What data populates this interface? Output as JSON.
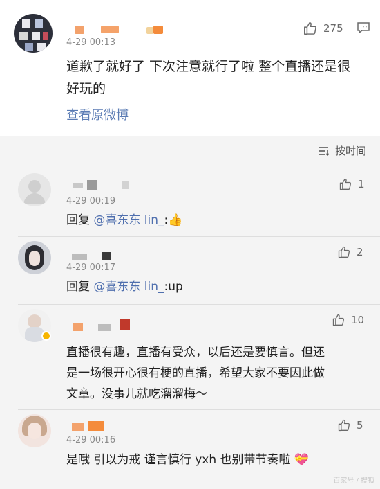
{
  "post": {
    "time": "4-29 00:13",
    "like_count": "275",
    "text_line1": "道歉了就好了 下次注意就行了啦 整个直播还是很",
    "text_line2": "好玩的",
    "view_original": "查看原微博"
  },
  "sort": {
    "label": "按时间"
  },
  "replies": [
    {
      "time": "4-29 00:19",
      "likes": "1",
      "prefix": "回复",
      "mention": "@喜东东 lin_",
      "suffix": ":👍"
    },
    {
      "time": "4-29 00:17",
      "likes": "2",
      "prefix": "回复",
      "mention": "@喜东东 lin_",
      "suffix": ":up"
    },
    {
      "time": "",
      "likes": "10",
      "line1": "直播很有趣，直播有受众，以后还是要慎言。但还",
      "line2": "是一场很开心很有梗的直播，希望大家不要因此做",
      "line3": "文章。没事儿就吃溜溜梅～"
    },
    {
      "time": "4-29 00:16",
      "likes": "5",
      "text": "是哦 引以为戒 谨言慎行 yxh 也别带节奏啦 💝"
    }
  ],
  "watermark": "百家号 / 搜狐",
  "icons": {
    "like": "thumb-up-icon",
    "comment": "comment-icon",
    "sort": "sort-icon"
  },
  "colors": {
    "link": "#5a7bb4",
    "text": "#222222",
    "muted": "#8a8a8a",
    "background": "#f4f4f4"
  }
}
